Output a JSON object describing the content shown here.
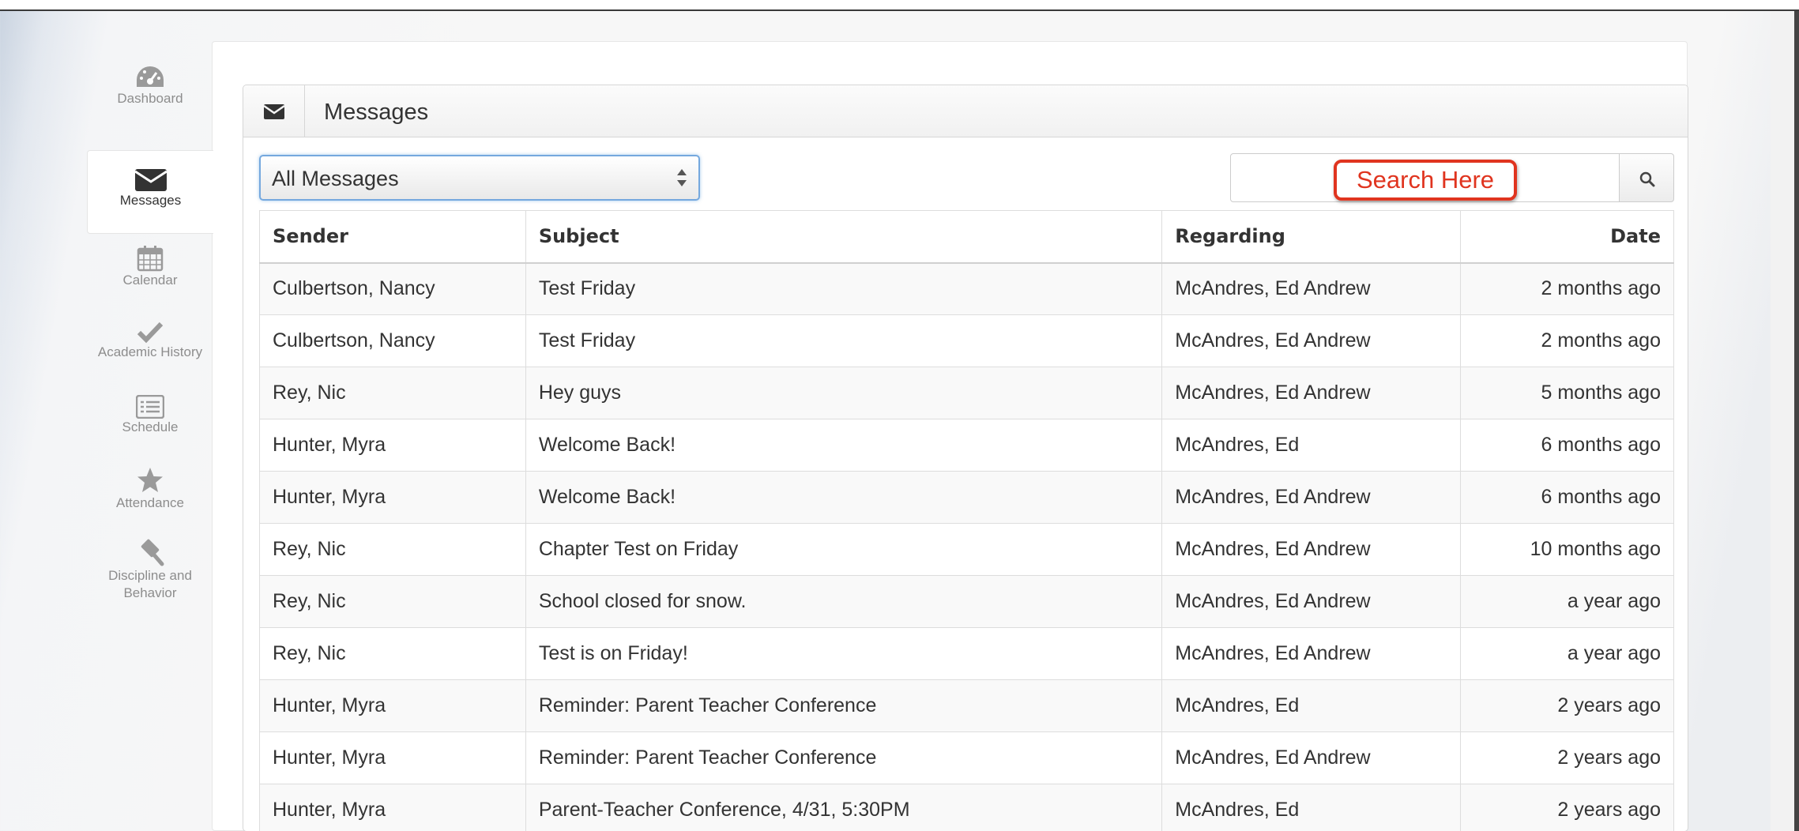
{
  "sidebar": {
    "items": [
      {
        "label": "Dashboard",
        "icon": "dashboard-icon"
      },
      {
        "label": "Messages",
        "icon": "envelope-icon",
        "active": true
      },
      {
        "label": "Calendar",
        "icon": "calendar-icon"
      },
      {
        "label": "Academic History",
        "icon": "checkmark-icon"
      },
      {
        "label": "Schedule",
        "icon": "list-icon"
      },
      {
        "label": "Attendance",
        "icon": "star-icon"
      },
      {
        "label": "Discipline and",
        "label2": "Behavior",
        "icon": "gavel-icon"
      }
    ]
  },
  "panel": {
    "title": "Messages",
    "icon": "envelope-icon"
  },
  "filter": {
    "selected": "All Messages"
  },
  "search": {
    "placeholder": "",
    "callout": "Search Here",
    "button_icon": "search-icon"
  },
  "table": {
    "headers": {
      "sender": "Sender",
      "subject": "Subject",
      "regarding": "Regarding",
      "date": "Date"
    },
    "rows": [
      {
        "sender": "Culbertson, Nancy",
        "subject": "Test Friday",
        "regarding": "McAndres, Ed Andrew",
        "date": "2 months ago"
      },
      {
        "sender": "Culbertson, Nancy",
        "subject": "Test Friday",
        "regarding": "McAndres, Ed Andrew",
        "date": "2 months ago"
      },
      {
        "sender": "Rey, Nic",
        "subject": "Hey guys",
        "regarding": "McAndres, Ed Andrew",
        "date": "5 months ago"
      },
      {
        "sender": "Hunter, Myra",
        "subject": "Welcome Back!",
        "regarding": "McAndres, Ed",
        "date": "6 months ago"
      },
      {
        "sender": "Hunter, Myra",
        "subject": "Welcome Back!",
        "regarding": "McAndres, Ed Andrew",
        "date": "6 months ago"
      },
      {
        "sender": "Rey, Nic",
        "subject": "Chapter Test on Friday",
        "regarding": "McAndres, Ed Andrew",
        "date": "10 months ago"
      },
      {
        "sender": "Rey, Nic",
        "subject": "School closed for snow.",
        "regarding": "McAndres, Ed Andrew",
        "date": "a year ago"
      },
      {
        "sender": "Rey, Nic",
        "subject": "Test is on Friday!",
        "regarding": "McAndres, Ed Andrew",
        "date": "a year ago"
      },
      {
        "sender": "Hunter, Myra",
        "subject": "Reminder: Parent Teacher Conference",
        "regarding": "McAndres, Ed",
        "date": "2 years ago"
      },
      {
        "sender": "Hunter, Myra",
        "subject": "Reminder: Parent Teacher Conference",
        "regarding": "McAndres, Ed Andrew",
        "date": "2 years ago"
      },
      {
        "sender": "Hunter, Myra",
        "subject": "Parent-Teacher Conference, 4/31, 5:30PM",
        "regarding": "McAndres, Ed",
        "date": "2 years ago"
      }
    ]
  },
  "colors": {
    "focus_border": "#75a8de",
    "callout_red": "#e0341f",
    "icon_gray": "#8d8d8d"
  }
}
